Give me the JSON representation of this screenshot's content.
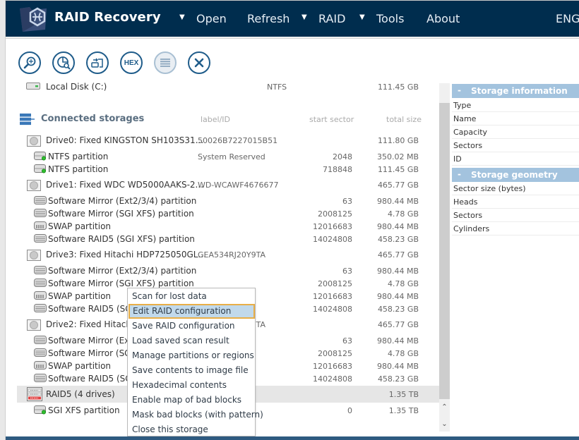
{
  "header": {
    "app_title": "RAID Recovery",
    "menu": [
      {
        "label": "Open",
        "has_dropdown": true
      },
      {
        "label": "Refresh",
        "has_dropdown": false
      },
      {
        "label": "RAID",
        "has_dropdown": true
      },
      {
        "label": "Tools",
        "has_dropdown": true
      },
      {
        "label": "About",
        "has_dropdown": false
      }
    ],
    "language": "ENG",
    "caret": "▼"
  },
  "toolbar": {
    "buttons": [
      {
        "name": "scan-button",
        "icon": "magnifier-scan-icon",
        "enabled": true
      },
      {
        "name": "file-search-button",
        "icon": "chart-search-icon",
        "enabled": true
      },
      {
        "name": "save-image-button",
        "icon": "disk-image-icon",
        "enabled": true
      },
      {
        "name": "hex-button",
        "icon": "hex-icon",
        "label": "HEX",
        "enabled": true
      },
      {
        "name": "list-button",
        "icon": "list-icon",
        "enabled": false
      },
      {
        "name": "close-button",
        "icon": "close-icon",
        "enabled": true
      }
    ]
  },
  "tree": {
    "local_disk": {
      "name": "Local Disk (C:)",
      "label": "NTFS",
      "size": "111.45 GB"
    },
    "section_title": "Connected storages",
    "columns": {
      "label": "label/ID",
      "start": "start sector",
      "size": "total size"
    },
    "rows": [
      {
        "type": "drive",
        "name": "Drive0: Fixed KINGSTON SH103S31...",
        "label": "50026B7227015B51",
        "start": "",
        "size": "111.80 GB"
      },
      {
        "type": "ntfs",
        "name": "NTFS partition",
        "label": "System Reserved",
        "start": "2048",
        "size": "350.02 MB"
      },
      {
        "type": "ntfs",
        "name": "NTFS partition",
        "label": "",
        "start": "718848",
        "size": "111.45 GB"
      },
      {
        "type": "drive",
        "name": "Drive1: Fixed WDC WD5000AAKS-2...",
        "label": "WD-WCAWF4676677",
        "start": "",
        "size": "465.77 GB"
      },
      {
        "type": "raidpart",
        "name": "Software Mirror (Ext2/3/4) partition",
        "label": "",
        "start": "63",
        "size": "980.44 MB"
      },
      {
        "type": "raidpart",
        "name": "Software Mirror (SGI XFS) partition",
        "label": "",
        "start": "2008125",
        "size": "4.78 GB"
      },
      {
        "type": "swap",
        "name": "SWAP partition",
        "label": "",
        "start": "12016683",
        "size": "980.44 MB"
      },
      {
        "type": "raidpart",
        "name": "Software RAID5 (SGI XFS) partition",
        "label": "",
        "start": "14024808",
        "size": "458.23 GB"
      },
      {
        "type": "drive",
        "name": "Drive3: Fixed Hitachi HDP725050GL...",
        "label": "GEA534RJ20Y9TA",
        "start": "",
        "size": "465.77 GB"
      },
      {
        "type": "raidpart",
        "name": "Software Mirror (Ext2/3/4) partition",
        "label": "",
        "start": "63",
        "size": "980.44 MB"
      },
      {
        "type": "raidpart",
        "name": "Software Mirror (SGI XFS) partition",
        "label": "",
        "start": "2008125",
        "size": "4.78 GB"
      },
      {
        "type": "swap",
        "name": "SWAP partition",
        "label": "",
        "start": "12016683",
        "size": "980.44 MB"
      },
      {
        "type": "raidpart",
        "name": "Software RAID5 (SGI XFS) partition",
        "label": "",
        "start": "14024808",
        "size": "458.23 GB"
      },
      {
        "type": "drive",
        "name": "Drive2: Fixed Hitachi HDP725050GL...",
        "label": "GEA534RJ20Y9TA",
        "start": "",
        "size": "465.77 GB"
      },
      {
        "type": "raidpart",
        "name": "Software Mirror (Ext2/3/4) partition",
        "label": "",
        "start": "63",
        "size": "980.44 MB"
      },
      {
        "type": "raidpart",
        "name": "Software Mirror (SGI XFS) partition",
        "label": "",
        "start": "2008125",
        "size": "4.78 GB"
      },
      {
        "type": "swap",
        "name": "SWAP partition",
        "label": "",
        "start": "12016683",
        "size": "980.44 MB"
      },
      {
        "type": "raidpart",
        "name": "Software RAID5 (SGI XFS) partition",
        "label": "",
        "start": "14024808",
        "size": "458.23 GB"
      },
      {
        "type": "raid",
        "name": "RAID5 (4 drives)",
        "label": "",
        "start": "",
        "size": "1.35 TB",
        "selected": true
      },
      {
        "type": "ntfs",
        "name": "SGI XFS partition",
        "label": "",
        "start": "0",
        "size": "1.35 TB"
      }
    ]
  },
  "properties": {
    "sections": [
      {
        "title": "Storage information",
        "toggle": "-",
        "rows": [
          "Type",
          "Name",
          "Capacity",
          "Sectors",
          "ID"
        ]
      },
      {
        "title": "Storage geometry",
        "toggle": "-",
        "rows": [
          "Sector size (bytes)",
          "Heads",
          "Sectors",
          "Cylinders"
        ]
      }
    ]
  },
  "context_menu": {
    "items": [
      {
        "label": "Scan for lost data"
      },
      {
        "label": "Edit RAID configuration",
        "active": true
      },
      {
        "label": "Save RAID configuration"
      },
      {
        "label": "Load saved scan result"
      },
      {
        "label": "Manage partitions or regions"
      },
      {
        "label": "Save contents to image file"
      },
      {
        "label": "Hexadecimal contents"
      },
      {
        "label": "Enable map of bad blocks"
      },
      {
        "label": "Mask bad blocks (with pattern)"
      },
      {
        "label": "Close this storage"
      }
    ]
  },
  "scrollbar": {
    "up": "⌃",
    "down": "⌄"
  },
  "colors": {
    "header_bg": "#002d4e",
    "accent": "#1f5c8a",
    "prop_header": "#a3c3de",
    "menu_highlight": "#c1d9eb",
    "menu_focus_border": "#e8ae47"
  }
}
